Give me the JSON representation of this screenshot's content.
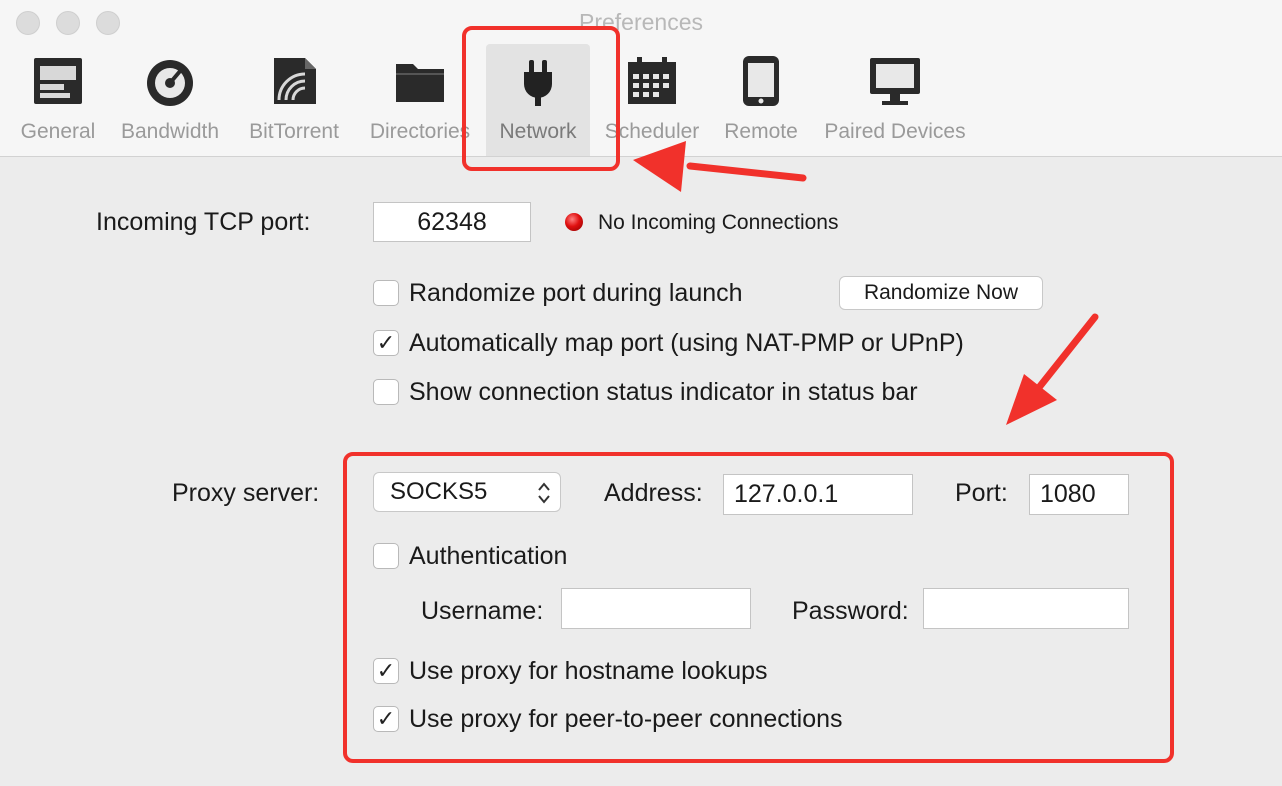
{
  "window": {
    "title": "Preferences"
  },
  "toolbar": {
    "tabs": [
      {
        "label": "General",
        "icon": "general-icon"
      },
      {
        "label": "Bandwidth",
        "icon": "gauge-icon"
      },
      {
        "label": "BitTorrent",
        "icon": "bittorrent-icon"
      },
      {
        "label": "Directories",
        "icon": "folder-icon"
      },
      {
        "label": "Network",
        "icon": "plug-icon",
        "selected": true
      },
      {
        "label": "Scheduler",
        "icon": "calendar-icon"
      },
      {
        "label": "Remote",
        "icon": "phone-icon"
      },
      {
        "label": "Paired Devices",
        "icon": "monitor-icon"
      }
    ]
  },
  "network": {
    "incoming_port_label": "Incoming TCP port:",
    "incoming_port_value": "62348",
    "status_text": "No Incoming Connections",
    "status_color": "#e01010",
    "randomize_label": "Randomize port during launch",
    "randomize_checked": false,
    "randomize_now_label": "Randomize Now",
    "automap_label": "Automatically map port (using NAT-PMP or UPnP)",
    "automap_checked": true,
    "show_status_label": "Show connection status indicator in status bar",
    "show_status_checked": false
  },
  "proxy": {
    "server_label": "Proxy server:",
    "type_value": "SOCKS5",
    "address_label": "Address:",
    "address_value": "127.0.0.1",
    "port_label": "Port:",
    "port_value": "1080",
    "auth_label": "Authentication",
    "auth_checked": false,
    "username_label": "Username:",
    "username_value": "",
    "password_label": "Password:",
    "password_value": "",
    "hostname_lookup_label": "Use proxy for hostname lookups",
    "hostname_lookup_checked": true,
    "p2p_label": "Use proxy for peer-to-peer connections",
    "p2p_checked": true
  },
  "checkmark_glyph": "✓",
  "annotation_color": "#f1312b"
}
